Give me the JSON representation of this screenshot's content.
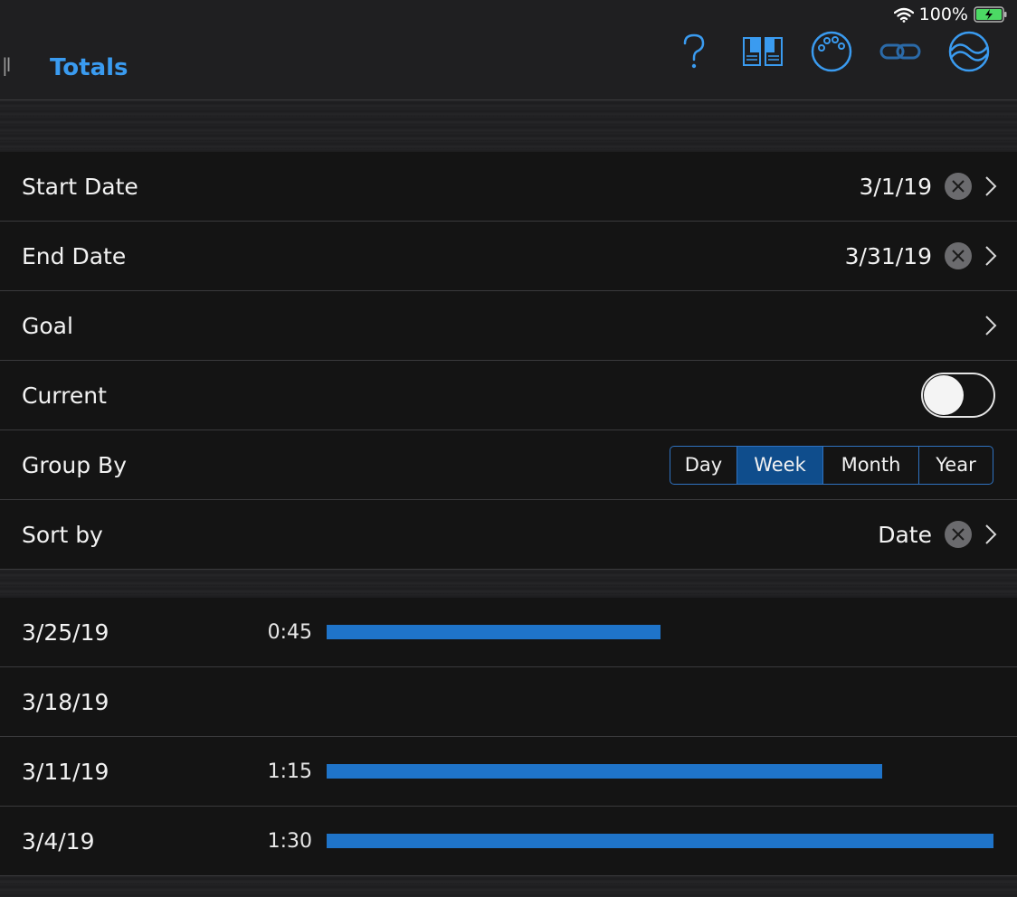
{
  "status_bar": {
    "battery_percent": "100%",
    "wifi_icon": "wifi-icon",
    "battery_icon": "battery-charging-icon"
  },
  "nav": {
    "title": "Totals",
    "handle": "|l",
    "icons": [
      "help-icon",
      "columns-icon",
      "palette-icon",
      "link-icon",
      "waveform-icon"
    ],
    "accent_color": "#3a9bf0"
  },
  "filters": {
    "start_date": {
      "label": "Start Date",
      "value": "3/1/19"
    },
    "end_date": {
      "label": "End Date",
      "value": "3/31/19"
    },
    "goal": {
      "label": "Goal"
    },
    "current": {
      "label": "Current",
      "enabled": false
    },
    "group_by": {
      "label": "Group By",
      "options": [
        "Day",
        "Week",
        "Month",
        "Year"
      ],
      "selected": "Week"
    },
    "sort_by": {
      "label": "Sort by",
      "value": "Date"
    }
  },
  "totals": [
    {
      "date": "3/25/19",
      "duration": "0:45",
      "minutes": 45
    },
    {
      "date": "3/18/19",
      "duration": "",
      "minutes": 0
    },
    {
      "date": "3/11/19",
      "duration": "1:15",
      "minutes": 75
    },
    {
      "date": "3/4/19",
      "duration": "1:30",
      "minutes": 90
    }
  ],
  "bar_color": "#1f74c9"
}
